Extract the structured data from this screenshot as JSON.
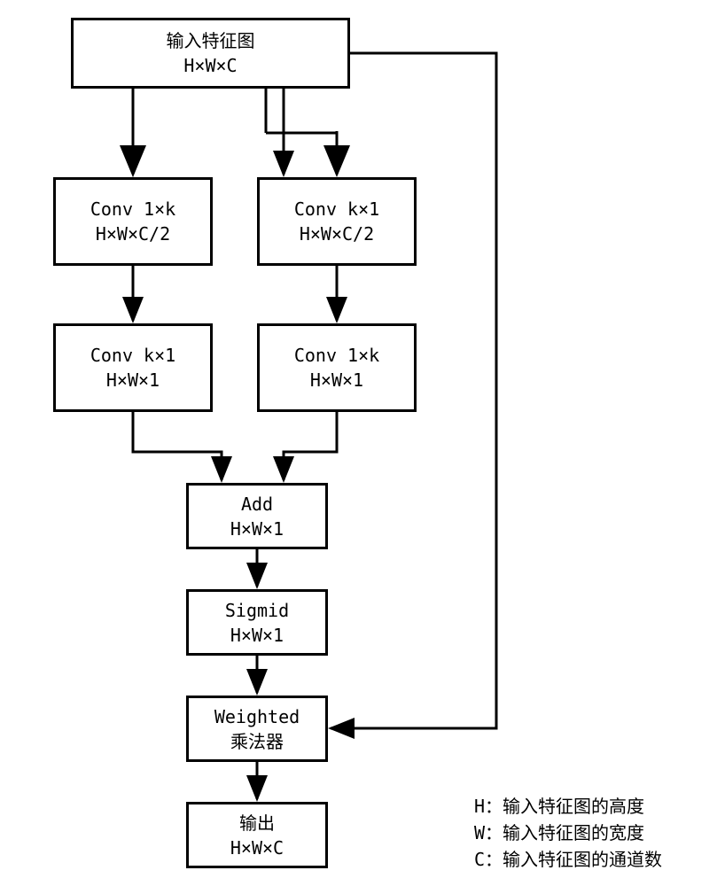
{
  "nodes": {
    "input": {
      "line1": "输入特征图",
      "line2": "H×W×C"
    },
    "convL1": {
      "line1": "Conv 1×k",
      "line2": "H×W×C/2"
    },
    "convR1": {
      "line1": "Conv k×1",
      "line2": "H×W×C/2"
    },
    "convL2": {
      "line1": "Conv k×1",
      "line2": "H×W×1"
    },
    "convR2": {
      "line1": "Conv 1×k",
      "line2": "H×W×1"
    },
    "add": {
      "line1": "Add",
      "line2": "H×W×1"
    },
    "sigmoid": {
      "line1": "Sigmid",
      "line2": "H×W×1"
    },
    "weighted": {
      "line1": "Weighted",
      "line2": "乘法器"
    },
    "output": {
      "line1": "输出",
      "line2": "H×W×C"
    }
  },
  "legend": {
    "h": "H：输入特征图的高度",
    "w": "W：输入特征图的宽度",
    "c": "C：输入特征图的通道数"
  }
}
